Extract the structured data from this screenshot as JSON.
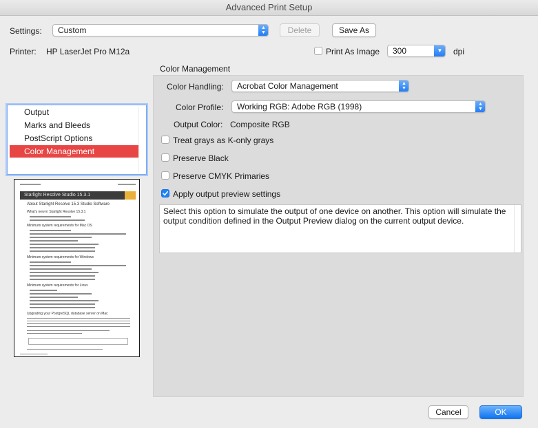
{
  "window": {
    "title": "Advanced Print Setup"
  },
  "settings": {
    "label": "Settings:",
    "value": "Custom",
    "delete_label": "Delete",
    "save_as_label": "Save As"
  },
  "printer": {
    "label": "Printer:",
    "name": "HP LaserJet Pro M12a"
  },
  "print_as_image": {
    "label": "Print As Image",
    "checked": false,
    "dpi_value": "300",
    "dpi_unit": "dpi"
  },
  "sidebar": {
    "items": [
      {
        "label": "Output",
        "selected": false
      },
      {
        "label": "Marks and Bleeds",
        "selected": false
      },
      {
        "label": "PostScript Options",
        "selected": false
      },
      {
        "label": "Color Management",
        "selected": true
      }
    ]
  },
  "preview": {
    "lines": [
      "Starlight Resolve Studio 15.3.1",
      "About Starlight Resolve 15.3 Studio Software",
      "What's new in Starlight Resolve 15.3.1",
      "Minimum system requirements for Mac OS",
      "Minimum system requirements for Windows",
      "Minimum system requirements for Linux",
      "Upgrading your PostgreSQL database server on Mac"
    ]
  },
  "color_management": {
    "section_title": "Color Management",
    "color_handling_label": "Color Handling:",
    "color_handling_value": "Acrobat Color Management",
    "color_profile_label": "Color Profile:",
    "color_profile_value": "Working RGB: Adobe RGB (1998)",
    "output_color_label": "Output Color:",
    "output_color_value": "Composite RGB",
    "options": [
      {
        "label": "Treat grays as K-only grays",
        "checked": false
      },
      {
        "label": "Preserve Black",
        "checked": false
      },
      {
        "label": "Preserve CMYK Primaries",
        "checked": false
      },
      {
        "label": "Apply output preview settings",
        "checked": true
      }
    ],
    "description": "Select this option to simulate the output of one device on another. This option will simulate the output condition defined in the Output Preview dialog on the current output device."
  },
  "footer": {
    "cancel_label": "Cancel",
    "ok_label": "OK"
  },
  "colors": {
    "accent": "#1a82fb",
    "selection": "#e84545",
    "panel": "#dcdcdc"
  }
}
